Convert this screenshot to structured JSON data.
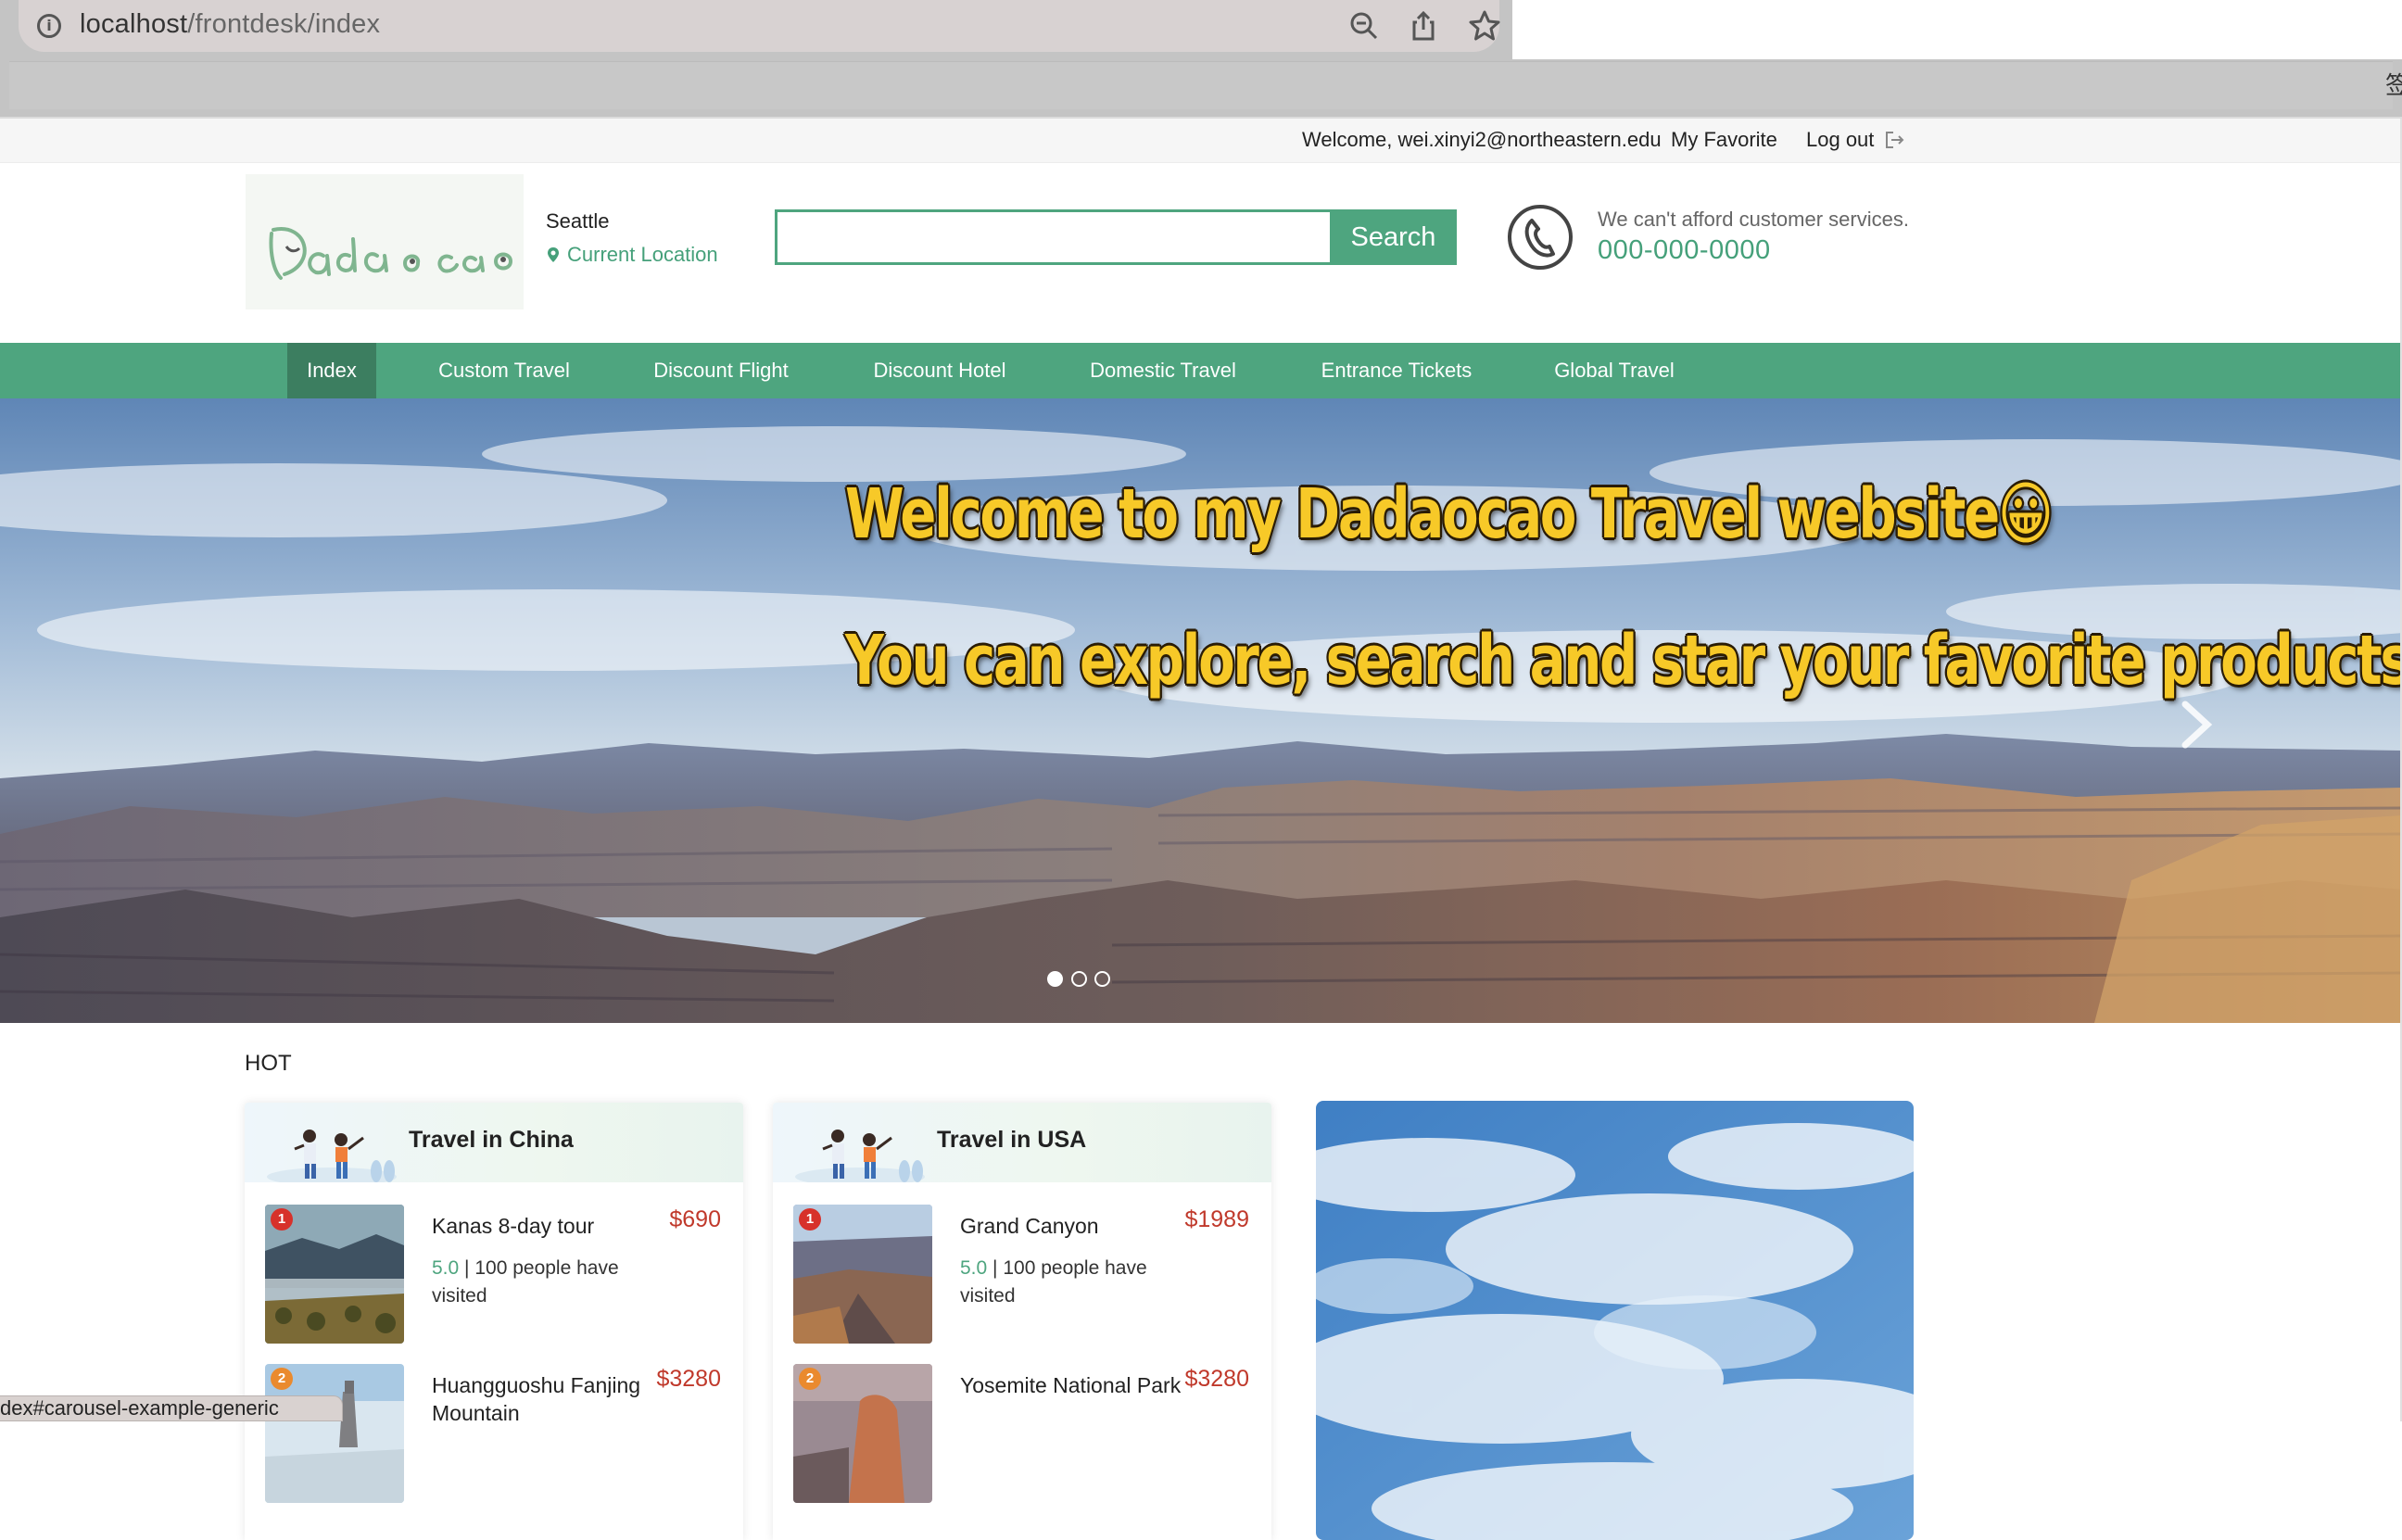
{
  "browser": {
    "url_host": "localhost",
    "url_path": "/frontdesk/index",
    "edge_glyph": "签",
    "status_url": "dex#carousel-example-generic"
  },
  "topbar": {
    "welcome": "Welcome, wei.xinyi2@northeastern.edu",
    "my_favorite": "My Favorite",
    "logout": "Log out"
  },
  "header": {
    "logo_text": "Dadaocao",
    "city": "Seattle",
    "current_location": "Current Location",
    "search_value": "",
    "search_button": "Search",
    "service_note": "We can't afford customer services.",
    "service_phone": "000-000-0000"
  },
  "nav": {
    "items": [
      {
        "label": "Index",
        "active": true
      },
      {
        "label": "Custom Travel"
      },
      {
        "label": "Discount Flight"
      },
      {
        "label": "Discount Hotel"
      },
      {
        "label": "Domestic Travel"
      },
      {
        "label": "Entrance Tickets"
      },
      {
        "label": "Global Travel"
      }
    ]
  },
  "hero": {
    "line1": "Welcome to my Dadaocao Travel website😀",
    "line2": "You can explore, search and star your favorite products!",
    "slides": 3,
    "active_slide": 1
  },
  "hot": {
    "label": "HOT",
    "cards": [
      {
        "title": "Travel in China",
        "items": [
          {
            "rank": "1",
            "name": "Kanas 8-day tour",
            "price": "$690",
            "score": "5.0",
            "visits": "| 100 people have visited"
          },
          {
            "rank": "2",
            "name": "Huangguoshu Fanjing Mountain",
            "price": "$3280"
          }
        ]
      },
      {
        "title": "Travel in USA",
        "items": [
          {
            "rank": "1",
            "name": "Grand Canyon",
            "price": "$1989",
            "score": "5.0",
            "visits": "| 100 people have visited"
          },
          {
            "rank": "2",
            "name": "Yosemite National Park",
            "price": "$3280"
          }
        ]
      }
    ]
  },
  "colors": {
    "brand_green": "#4ea57f",
    "nav_active": "#3c7e60",
    "price_red": "#c0392b",
    "hero_text": "#f7c928"
  }
}
